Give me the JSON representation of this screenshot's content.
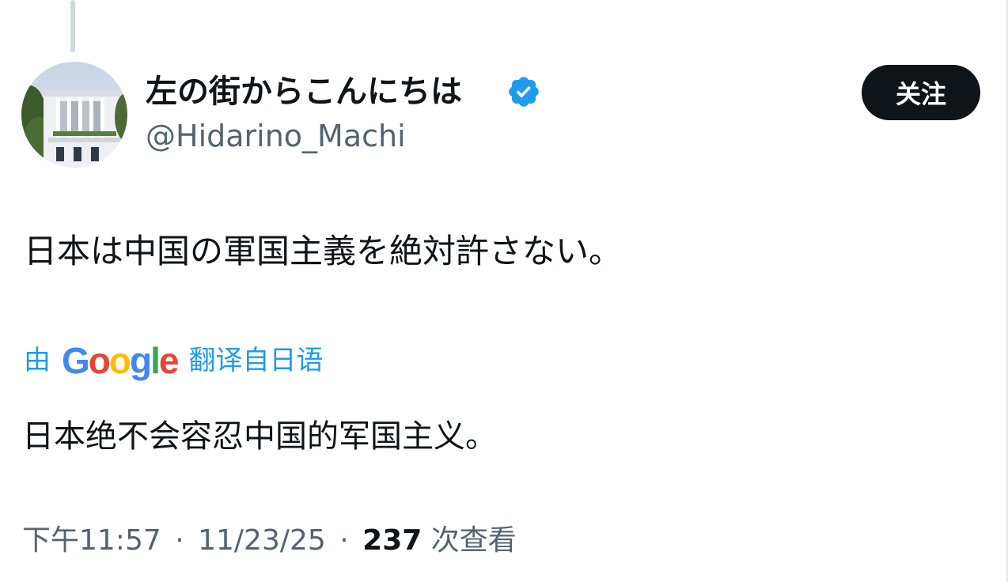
{
  "author": {
    "display_name": "左の街からこんにちは",
    "handle": "@Hidarino_Machi",
    "verified_icon": "verified-badge-icon",
    "verified_color": "#1d9bf0"
  },
  "follow_button": {
    "label": "关注"
  },
  "tweet": {
    "text": "日本は中国の軍国主義を絶対許さない。"
  },
  "translation": {
    "prefix": "由",
    "provider_letters": [
      "G",
      "o",
      "o",
      "g",
      "l",
      "e"
    ],
    "suffix": "翻译自日语",
    "translated_text": "日本绝不会容忍中国的军国主义。"
  },
  "meta": {
    "time": "下午11:57",
    "separator": "·",
    "date": "11/23/25",
    "views_count": "237",
    "views_label": "次查看"
  },
  "colors": {
    "text": "#0f1419",
    "secondary": "#536471",
    "accent": "#1d9bf0",
    "button_bg": "#0f1419"
  }
}
